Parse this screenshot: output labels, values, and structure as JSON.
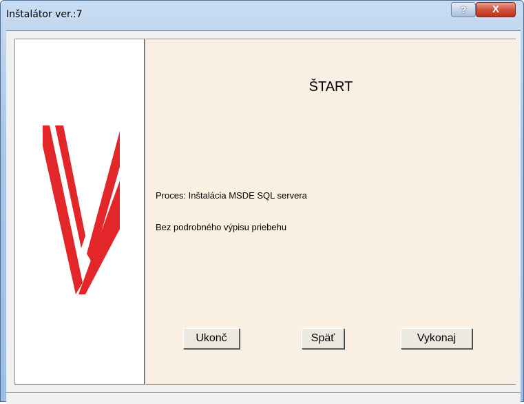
{
  "window": {
    "title": "Inštalátor ver.:7"
  },
  "titlebar": {
    "help_label": "?",
    "close_label": "X"
  },
  "main": {
    "heading": "ŠTART",
    "process_text": "Proces: Inštalácia MSDE SQL servera",
    "verbosity_text": "Bez podrobného výpisu priebehu"
  },
  "buttons": {
    "quit": "Ukonč",
    "back": "Späť",
    "execute": "Vykonaj"
  },
  "colors": {
    "logo_red": "#e3262a",
    "panel_background": "#f9efe2",
    "titlebar_blue": "#a9c6e8",
    "close_red": "#c7412a"
  }
}
